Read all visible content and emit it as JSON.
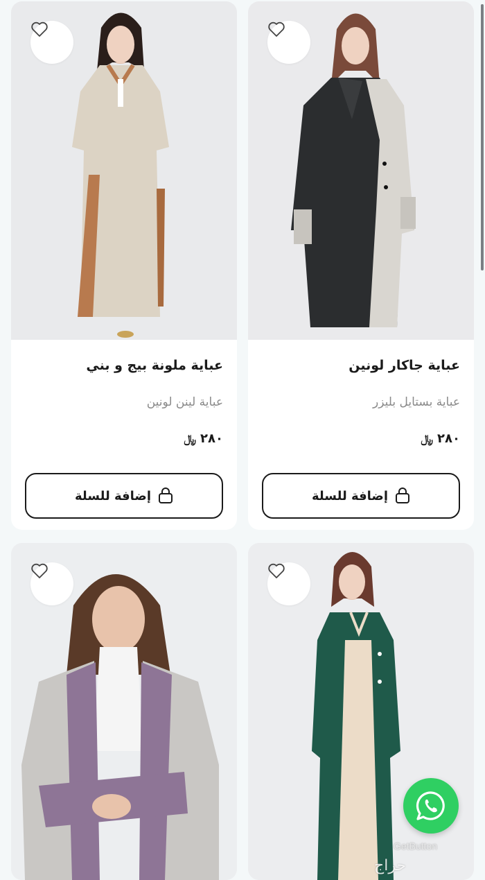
{
  "products": [
    {
      "title": "عباية جاكار لونين",
      "subtitle": "عباية بستايل بليزر",
      "price": "٢٨٠",
      "currency": "﷼",
      "cart_label": "إضافة للسلة",
      "colors": {
        "main": "#2b2d2f",
        "accent": "#d9d6d0"
      }
    },
    {
      "title": "عباية ملونة بيج و بني",
      "subtitle": "عباية لينن لونين",
      "price": "٢٨٠",
      "currency": "﷼",
      "cart_label": "إضافة للسلة",
      "colors": {
        "main": "#dcd3c4",
        "accent": "#b87a4e"
      }
    },
    {
      "title": "",
      "subtitle": "",
      "price": "",
      "currency": "",
      "cart_label": "",
      "colors": {
        "main": "#1f5a4a",
        "accent": "#ecdcc8"
      }
    },
    {
      "title": "",
      "subtitle": "",
      "price": "",
      "currency": "",
      "cart_label": "",
      "colors": {
        "main": "#c9c7c4",
        "accent": "#8e7596"
      }
    }
  ],
  "icons": {
    "favorite": "heart-outline-icon",
    "cart": "shopping-bag-icon",
    "chat": "whatsapp-icon"
  },
  "widget": {
    "brand": "GetButton"
  },
  "watermark": "حراج"
}
